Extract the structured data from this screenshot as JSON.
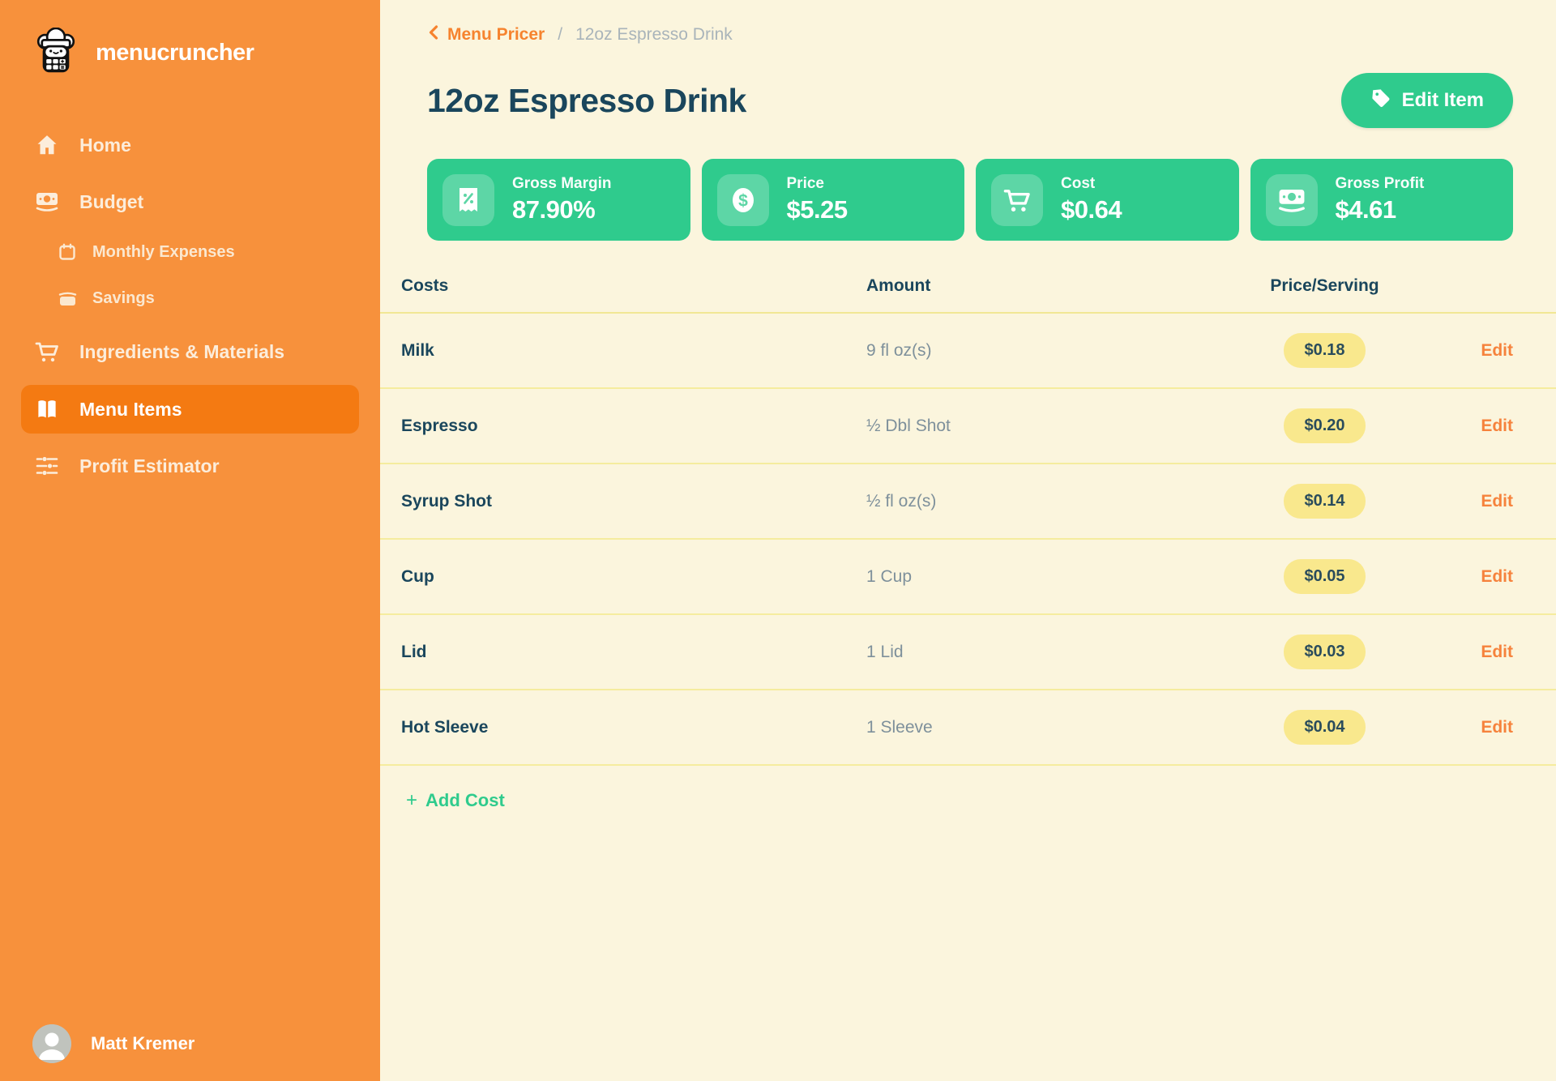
{
  "app": {
    "name": "menucruncher"
  },
  "sidebar": {
    "items": [
      {
        "label": "Home",
        "icon": "home-icon"
      },
      {
        "label": "Budget",
        "icon": "banknote-icon"
      },
      {
        "label": "Monthly Expenses",
        "icon": "calendar-icon"
      },
      {
        "label": "Savings",
        "icon": "wallet-icon"
      },
      {
        "label": "Ingredients & Materials",
        "icon": "cart-icon"
      },
      {
        "label": "Menu Items",
        "icon": "open-book-icon"
      },
      {
        "label": "Profit Estimator",
        "icon": "sliders-icon"
      }
    ],
    "user": {
      "name": "Matt Kremer"
    }
  },
  "breadcrumb": {
    "back": "Menu Pricer",
    "separator": "/",
    "current": "12oz Espresso Drink"
  },
  "header": {
    "title": "12oz Espresso Drink",
    "edit_button": "Edit Item"
  },
  "stats": [
    {
      "label": "Gross Margin",
      "value": "87.90%",
      "icon": "receipt-percent-icon"
    },
    {
      "label": "Price",
      "value": "$5.25",
      "icon": "dollar-coin-icon"
    },
    {
      "label": "Cost",
      "value": "$0.64",
      "icon": "cart-icon"
    },
    {
      "label": "Gross Profit",
      "value": "$4.61",
      "icon": "banknote-icon"
    }
  ],
  "table": {
    "headers": [
      "Costs",
      "Amount",
      "Price/Serving"
    ],
    "rows": [
      {
        "name": "Milk",
        "amount": "9 fl oz(s)",
        "price": "$0.18",
        "action": "Edit"
      },
      {
        "name": "Espresso",
        "amount": "½ Dbl Shot",
        "price": "$0.20",
        "action": "Edit"
      },
      {
        "name": "Syrup Shot",
        "amount": "½ fl oz(s)",
        "price": "$0.14",
        "action": "Edit"
      },
      {
        "name": "Cup",
        "amount": "1 Cup",
        "price": "$0.05",
        "action": "Edit"
      },
      {
        "name": "Lid",
        "amount": "1 Lid",
        "price": "$0.03",
        "action": "Edit"
      },
      {
        "name": "Hot Sleeve",
        "amount": "1 Sleeve",
        "price": "$0.04",
        "action": "Edit"
      }
    ],
    "add_cost": "Add Cost"
  },
  "colors": {
    "sidebar_bg": "#F7913C",
    "sidebar_active": "#F47A12",
    "main_bg": "#FBF5DD",
    "green": "#2FCB8D",
    "green_badge": "#5DD6A6",
    "navy": "#1A465C",
    "orange_accent": "#F6832E",
    "pill_yellow": "#F9E88D",
    "divider_yellow": "#F5EC9E",
    "muted_gray": "#7E909B"
  }
}
